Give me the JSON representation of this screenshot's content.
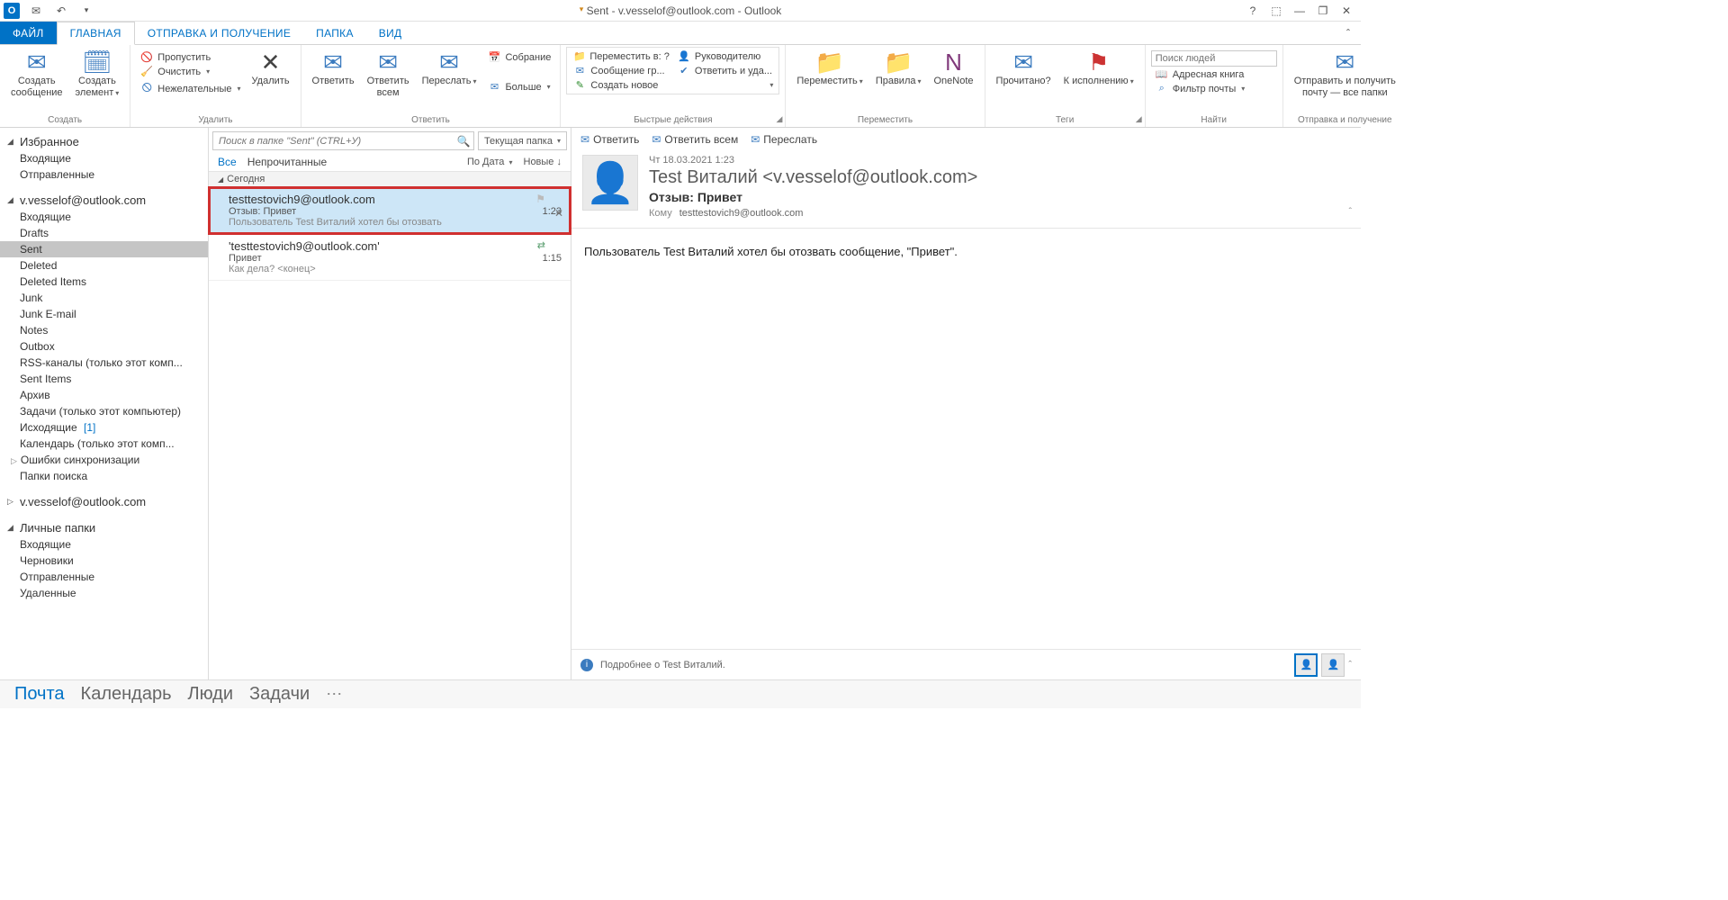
{
  "window": {
    "title": "Sent - v.vesselof@outlook.com - Outlook"
  },
  "tabs": {
    "file": "ФАЙЛ",
    "home": "ГЛАВНАЯ",
    "sendreceive": "ОТПРАВКА И ПОЛУЧЕНИЕ",
    "folder": "ПАПКА",
    "view": "ВИД"
  },
  "ribbon": {
    "new": {
      "new_mail": "Создать\nсообщение",
      "new_item": "Создать\nэлемент",
      "group": "Создать"
    },
    "delete": {
      "ignore": "Пропустить",
      "clean": "Очистить",
      "junk": "Нежелательные",
      "delete": "Удалить",
      "group": "Удалить"
    },
    "respond": {
      "reply": "Ответить",
      "reply_all": "Ответить\nвсем",
      "forward": "Переслать",
      "meeting": "Собрание",
      "more": "Больше",
      "group": "Ответить"
    },
    "quick": {
      "move_to": "Переместить в: ?",
      "team": "Сообщение гр...",
      "create": "Создать новое",
      "manager": "Руководителю",
      "reply_del": "Ответить и уда...",
      "group": "Быстрые действия"
    },
    "move": {
      "move": "Переместить",
      "rules": "Правила",
      "onenote": "OneNote",
      "group": "Переместить"
    },
    "tags": {
      "read": "Прочитано?",
      "followup": "К исполнению",
      "group": "Теги"
    },
    "find": {
      "search_ph": "Поиск людей",
      "addr": "Адресная книга",
      "filter": "Фильтр почты",
      "group": "Найти"
    },
    "sr": {
      "btn": "Отправить и получить\nпочту — все папки",
      "group": "Отправка и получение"
    }
  },
  "folders": {
    "fav_hdr": "Избранное",
    "fav": [
      "Входящие",
      "Отправленные"
    ],
    "acct1": "v.vesselof@outlook.com",
    "acct1_items": [
      {
        "label": "Входящие"
      },
      {
        "label": "Drafts"
      },
      {
        "label": "Sent",
        "selected": true
      },
      {
        "label": "Deleted"
      },
      {
        "label": "Deleted Items"
      },
      {
        "label": "Junk"
      },
      {
        "label": "Junk E-mail"
      },
      {
        "label": "Notes"
      },
      {
        "label": "Outbox"
      },
      {
        "label": "RSS-каналы (только этот комп..."
      },
      {
        "label": "Sent Items"
      },
      {
        "label": "Архив"
      },
      {
        "label": "Задачи (только этот компьютер)"
      },
      {
        "label": "Исходящие",
        "count": "[1]"
      },
      {
        "label": "Календарь (только этот комп..."
      },
      {
        "label": "Ошибки синхронизации",
        "exp": true
      },
      {
        "label": "Папки поиска"
      }
    ],
    "acct2": "v.vesselof@outlook.com",
    "local_hdr": "Личные папки",
    "local": [
      "Входящие",
      "Черновики",
      "Отправленные",
      "Удаленные"
    ]
  },
  "msglist": {
    "search_ph": "Поиск в папке \"Sent\" (CTRL+У)",
    "scope": "Текущая папка",
    "all": "Все",
    "unread": "Непрочитанные",
    "sort_by": "По Дата",
    "newest": "Новые",
    "group_today": "Сегодня",
    "m1": {
      "from": "testtestovich9@outlook.com",
      "subj": "Отзыв: Привет",
      "time": "1:23",
      "prev": "Пользователь Test Виталий хотел бы отозвать"
    },
    "m2": {
      "from": "'testtestovich9@outlook.com'",
      "subj": "Привет",
      "time": "1:15",
      "prev": "Как дела?  <конец>"
    }
  },
  "reading": {
    "reply": "Ответить",
    "reply_all": "Ответить всем",
    "forward": "Переслать",
    "date": "Чт 18.03.2021 1:23",
    "from": "Test Виталий <v.vesselof@outlook.com>",
    "subject": "Отзыв: Привет",
    "to_lbl": "Кому",
    "to": "testtestovich9@outlook.com",
    "body": "Пользователь Test Виталий хотел бы отозвать сообщение, \"Привет\".",
    "footer_info": "Подробнее о Test Виталий."
  },
  "nav": {
    "mail": "Почта",
    "calendar": "Календарь",
    "people": "Люди",
    "tasks": "Задачи"
  }
}
